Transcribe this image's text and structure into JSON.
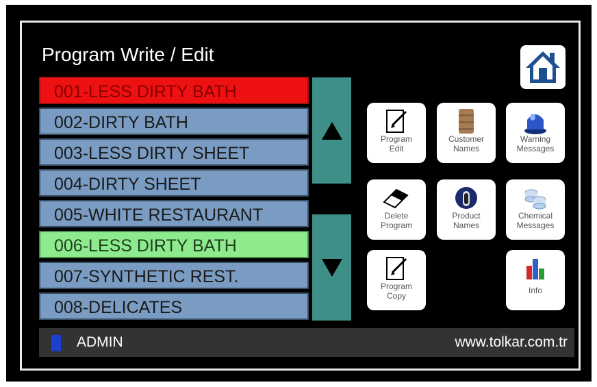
{
  "title": "Program Write / Edit",
  "programs": [
    "001-LESS DIRTY BATH",
    "002-DIRTY BATH",
    "003-LESS DIRTY SHEET",
    "004-DIRTY SHEET",
    "005-WHITE RESTAURANT",
    "006-LESS DIRTY BATH",
    "007-SYNTHETIC REST.",
    "008-DELICATES"
  ],
  "selected_index": 0,
  "highlighted_index": 5,
  "tiles": {
    "program_edit": [
      "Program",
      "Edit"
    ],
    "customer_names": [
      "Customer",
      "Names"
    ],
    "warning_messages": [
      "Warning",
      "Messages"
    ],
    "delete_program": [
      "Delete",
      "Program"
    ],
    "product_names": [
      "Product",
      "Names"
    ],
    "chemical_messages": [
      "Chemical",
      "Messages"
    ],
    "program_copy": [
      "Program",
      "Copy"
    ],
    "info": [
      "Info"
    ]
  },
  "footer": {
    "user": "ADMIN",
    "website": "www.tolkar.com.tr"
  },
  "icons": {
    "home": "home-icon",
    "scroll_up": "arrow-up-icon",
    "scroll_down": "arrow-down-icon",
    "user": "user-icon"
  },
  "colors": {
    "selected_row": "#ee1111",
    "highlight_row": "#8dea8d",
    "row": "#7a9cc3",
    "scroll_button": "#3e8f88"
  }
}
